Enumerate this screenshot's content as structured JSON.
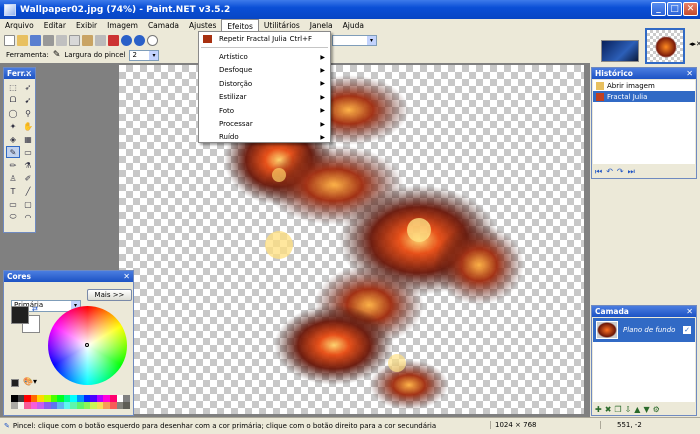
{
  "window": {
    "title": "Wallpaper02.jpg (74%) - Paint.NET v3.5.2"
  },
  "menu": [
    "Arquivo",
    "Editar",
    "Exibir",
    "Imagem",
    "Camada",
    "Ajustes",
    "Efeitos",
    "Utilitários",
    "Janela",
    "Ajuda"
  ],
  "menu_active_index": 6,
  "toolbar2": {
    "tool_label": "Ferramenta:",
    "brush_width_label": "Largura do pincel",
    "brush_width_value": "2"
  },
  "effects_menu": {
    "repeat_label": "Repetir Fractal Julia",
    "repeat_shortcut": "Ctrl+F",
    "items": [
      "Artístico",
      "Desfoque",
      "Distorção",
      "Estilizar",
      "Foto",
      "Processar",
      "Ruído"
    ]
  },
  "panels": {
    "tools_title": "Ferr...",
    "colors_title": "Cores",
    "colors_mode": "Primária",
    "colors_more": "Mais >>",
    "history_title": "Histórico",
    "history_items": [
      "Abrir imagem",
      "Fractal Julia"
    ],
    "layers_title": "Camada",
    "layer_name": "Plano de fundo"
  },
  "status": {
    "hint": "Pincel: clique com o botão esquerdo para desenhar com a cor primária; clique com o botão direito para a cor secundária",
    "size": "1024 × 768",
    "coords": "551, -2"
  },
  "palette": [
    "#000000",
    "#404040",
    "#ff0000",
    "#ff6a00",
    "#ffd800",
    "#b6ff00",
    "#4cff00",
    "#00ff21",
    "#00ff90",
    "#00ffff",
    "#0094ff",
    "#0026ff",
    "#4800ff",
    "#b200ff",
    "#ff00dc",
    "#ff006e",
    "#ffffff",
    "#808080"
  ]
}
